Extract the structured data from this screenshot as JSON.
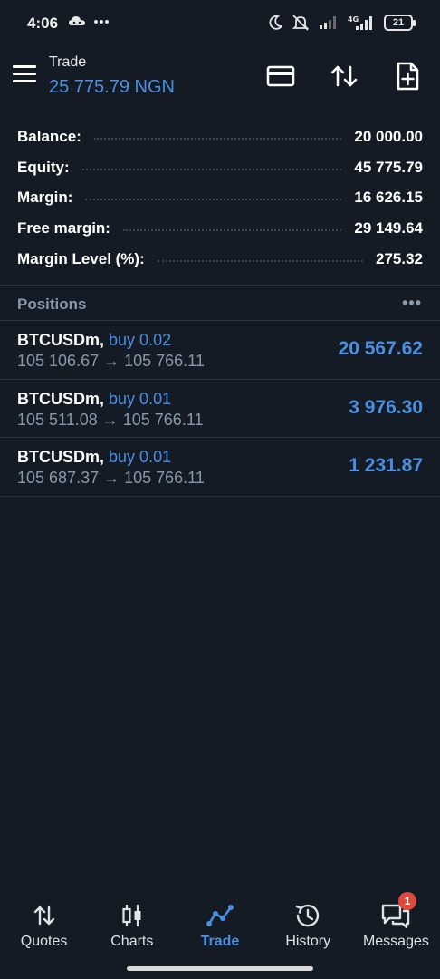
{
  "status_bar": {
    "time": "4:06",
    "battery": "21",
    "icons": [
      "cloud-game-icon",
      "more-dots-icon",
      "moon-icon",
      "mute-icon",
      "signal-icon",
      "4g-signal-icon",
      "battery-icon"
    ]
  },
  "header": {
    "title": "Trade",
    "balance_display": "25 775.79 NGN",
    "icons": [
      "menu-icon",
      "card-icon",
      "sort-icon",
      "new-order-icon"
    ]
  },
  "summary": [
    {
      "label": "Balance:",
      "value": "20 000.00"
    },
    {
      "label": "Equity:",
      "value": "45 775.79"
    },
    {
      "label": "Margin:",
      "value": "16 626.15"
    },
    {
      "label": "Free margin:",
      "value": "29 149.64"
    },
    {
      "label": "Margin Level (%):",
      "value": "275.32"
    }
  ],
  "positions": {
    "title": "Positions",
    "more": "•••",
    "items": [
      {
        "symbol": "BTCUSDm,",
        "side": "buy 0.02",
        "prices": "105 106.67 → 105 766.11",
        "profit": "20 567.62"
      },
      {
        "symbol": "BTCUSDm,",
        "side": "buy 0.01",
        "prices": "105 511.08 → 105 766.11",
        "profit": "3 976.30"
      },
      {
        "symbol": "BTCUSDm,",
        "side": "buy 0.01",
        "prices": "105 687.37 → 105 766.11",
        "profit": "1 231.87"
      }
    ]
  },
  "bottom_nav": {
    "items": [
      {
        "label": "Quotes",
        "icon": "quotes-icon"
      },
      {
        "label": "Charts",
        "icon": "charts-icon"
      },
      {
        "label": "Trade",
        "icon": "trade-icon"
      },
      {
        "label": "History",
        "icon": "history-icon"
      },
      {
        "label": "Messages",
        "icon": "messages-icon"
      }
    ],
    "active": "Trade",
    "messages_badge": "1"
  },
  "colors": {
    "background": "#141b24",
    "accent": "#4a90e2",
    "muted": "#8a97a6",
    "badge": "#e0483e"
  }
}
